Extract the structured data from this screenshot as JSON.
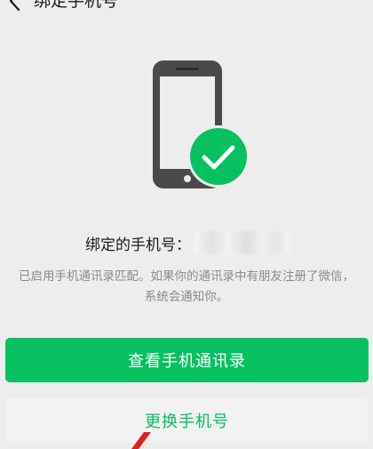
{
  "header": {
    "title": "绑定手机号"
  },
  "main": {
    "bound_label": "绑定的手机号：",
    "description_line1": "已启用手机通讯录匹配。如果你的通讯录中有朋友注册了微信，",
    "description_line2": "系统会通知你。",
    "primary_button": "查看手机通讯录",
    "secondary_button": "更换手机号"
  },
  "icons": {
    "back": "chevron-left-icon",
    "phone": "smartphone-icon",
    "check": "check-circle-icon",
    "annotation": "red-arrow-icon"
  },
  "colors": {
    "accent": "#07c160",
    "background": "#ededed",
    "phone": "#4a4a4a",
    "annotation": "#e02020"
  }
}
